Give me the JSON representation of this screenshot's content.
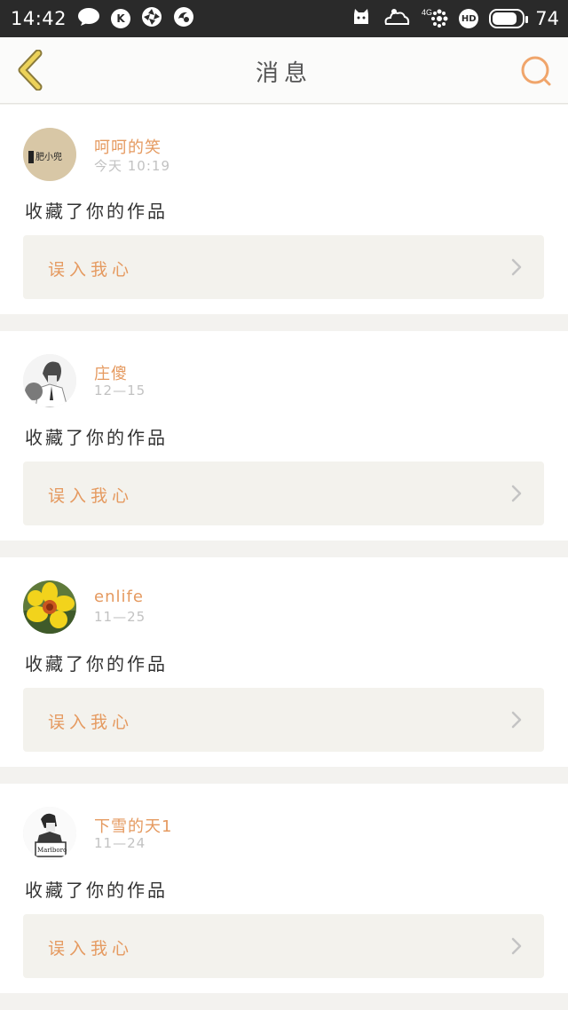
{
  "status_bar": {
    "time": "14:42",
    "battery": "74",
    "battery_level": 0.74,
    "left_icons": [
      "chat-icon",
      "k-app-icon",
      "aperture-icon",
      "swirl-app-icon"
    ],
    "right_icons": [
      "cat-app-icon",
      "cloud-app-icon",
      "4g-signal-icon",
      "hd-icon",
      "battery-icon"
    ],
    "hd_label": "HD",
    "net_label": "4G",
    "k_label": "K"
  },
  "header": {
    "title": "消息",
    "accent_color": "#f0a56b",
    "back_color": "#e8c84e"
  },
  "messages": [
    {
      "user": "呵呵的笑",
      "time": "今天 10:19",
      "text": "收藏了你的作品",
      "work": "误入我心",
      "avatar": "avatar-beige-logo",
      "avatar_text": "肥小兜"
    },
    {
      "user": "庄傻",
      "time": "12—15",
      "text": "收藏了你的作品",
      "work": "误入我心",
      "avatar": "avatar-anime-sketch"
    },
    {
      "user": "enlife",
      "time": "11—25",
      "text": "收藏了你的作品",
      "work": "误入我心",
      "avatar": "avatar-yellow-flower"
    },
    {
      "user": "下雪的天1",
      "time": "11—24",
      "text": "收藏了你的作品",
      "work": "误入我心",
      "avatar": "avatar-marlboro-sketch",
      "avatar_text": "Marlboro"
    }
  ]
}
